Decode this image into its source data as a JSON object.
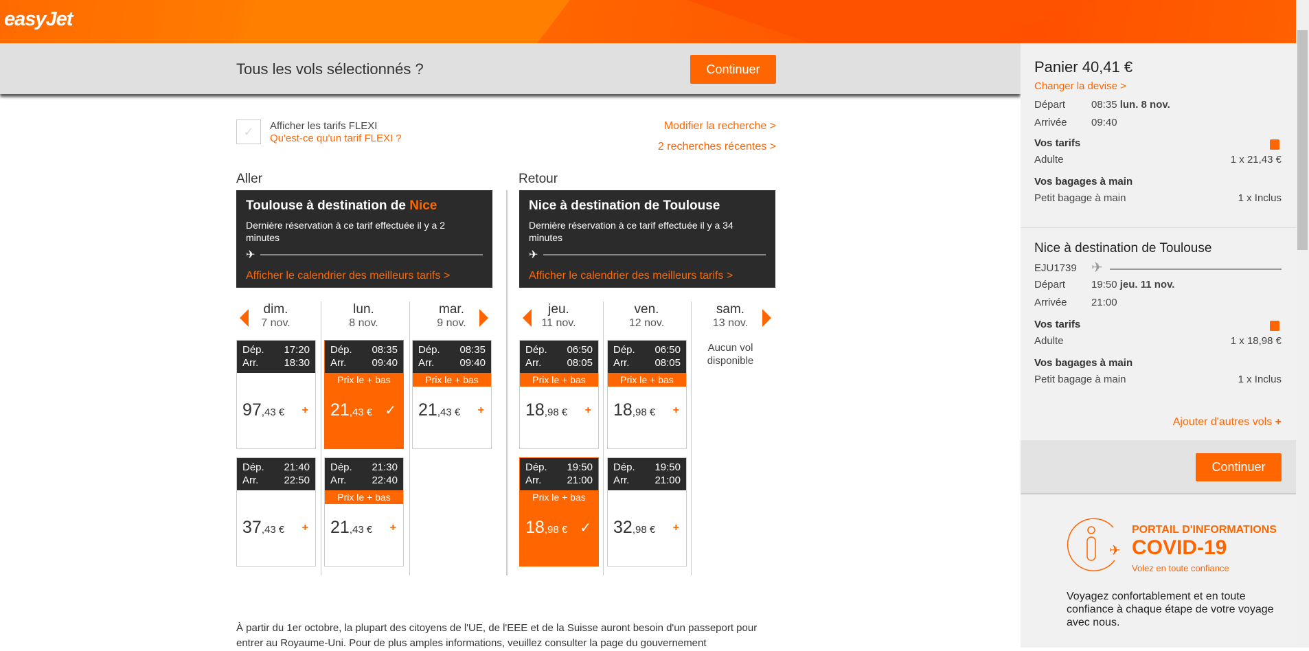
{
  "header": {
    "logo": "easyJet"
  },
  "bar": {
    "title": "Tous les vols sélectionnés ?",
    "continue": "Continuer"
  },
  "options": {
    "flexi_label": "Afficher les tarifs FLEXI",
    "flexi_help": "Qu'est-ce qu'un tarif FLEXI ?",
    "flexi_checked": false,
    "modify": "Modifier la recherche >",
    "recent": "2 recherches récentes >"
  },
  "outbound": {
    "section": "Aller",
    "title_prefix": "Toulouse à destination de ",
    "title_dest": "Nice",
    "last_booking": "Dernière réservation à ce tarif effectuée il y a 2 minutes",
    "calendar": "Afficher le calendrier des meilleurs tarifs >",
    "days": [
      {
        "day": "dim.",
        "date": "7 nov.",
        "flights": [
          {
            "dep_label": "Dép.",
            "dep": "17:20",
            "arr_label": "Arr.",
            "arr": "18:30",
            "badge": "",
            "int": "97",
            "dec": ",43 €",
            "selected": false
          },
          {
            "dep_label": "Dép.",
            "dep": "21:40",
            "arr_label": "Arr.",
            "arr": "22:50",
            "badge": "",
            "int": "37",
            "dec": ",43 €",
            "selected": false
          }
        ]
      },
      {
        "day": "lun.",
        "date": "8 nov.",
        "flights": [
          {
            "dep_label": "Dép.",
            "dep": "08:35",
            "arr_label": "Arr.",
            "arr": "09:40",
            "badge": "Prix le + bas",
            "int": "21",
            "dec": ",43 €",
            "selected": true
          },
          {
            "dep_label": "Dép.",
            "dep": "21:30",
            "arr_label": "Arr.",
            "arr": "22:40",
            "badge": "Prix le + bas",
            "int": "21",
            "dec": ",43 €",
            "selected": false
          }
        ]
      },
      {
        "day": "mar.",
        "date": "9 nov.",
        "flights": [
          {
            "dep_label": "Dép.",
            "dep": "08:35",
            "arr_label": "Arr.",
            "arr": "09:40",
            "badge": "Prix le + bas",
            "int": "21",
            "dec": ",43 €",
            "selected": false
          }
        ]
      }
    ]
  },
  "return": {
    "section": "Retour",
    "title_prefix": "Nice à destination de ",
    "title_dest": "Toulouse",
    "last_booking": "Dernière réservation à ce tarif effectuée il y a 34 minutes",
    "calendar": "Afficher le calendrier des meilleurs tarifs >",
    "days": [
      {
        "day": "jeu.",
        "date": "11 nov.",
        "flights": [
          {
            "dep_label": "Dép.",
            "dep": "06:50",
            "arr_label": "Arr.",
            "arr": "08:05",
            "badge": "Prix le + bas",
            "int": "18",
            "dec": ",98 €",
            "selected": false
          },
          {
            "dep_label": "Dép.",
            "dep": "19:50",
            "arr_label": "Arr.",
            "arr": "21:00",
            "badge": "Prix le + bas",
            "int": "18",
            "dec": ",98 €",
            "selected": true
          }
        ]
      },
      {
        "day": "ven.",
        "date": "12 nov.",
        "flights": [
          {
            "dep_label": "Dép.",
            "dep": "06:50",
            "arr_label": "Arr.",
            "arr": "08:05",
            "badge": "Prix le + bas",
            "int": "18",
            "dec": ",98 €",
            "selected": false
          },
          {
            "dep_label": "Dép.",
            "dep": "19:50",
            "arr_label": "Arr.",
            "arr": "21:00",
            "badge": "",
            "int": "32",
            "dec": ",98 €",
            "selected": false
          }
        ]
      },
      {
        "day": "sam.",
        "date": "13 nov.",
        "none": "Aucun vol disponible",
        "flights": []
      }
    ]
  },
  "footer": {
    "text": "À partir du 1er octobre, la plupart des citoyens de l'UE, de l'EEE et de la Suisse auront besoin d'un passeport pour entrer au Royaume-Uni. Pour de plus amples informations, veuillez consulter la page du gouvernement"
  },
  "basket": {
    "title": "Panier 40,41 €",
    "currency": "Changer la devise >",
    "f1": {
      "dep_label": "Départ",
      "dep_time": "08:35",
      "dep_date": "lun. 8 nov.",
      "arr_label": "Arrivée",
      "arr_time": "09:40",
      "fares": "Vos tarifs",
      "pax": "Adulte",
      "price": "1 x 21,43 €",
      "bags": "Vos bagages à main",
      "bag": "Petit bagage à main",
      "bag_qty": "1 x Inclus"
    },
    "f2": {
      "title": "Nice à destination de Toulouse",
      "flight_no": "EJU1739",
      "dep_label": "Départ",
      "dep_time": "19:50",
      "dep_date": "jeu. 11 nov.",
      "arr_label": "Arrivée",
      "arr_time": "21:00",
      "fares": "Vos tarifs",
      "pax": "Adulte",
      "price": "1 x 18,98 €",
      "bags": "Vos bagages à main",
      "bag": "Petit bagage à main",
      "bag_qty": "1 x Inclus"
    },
    "add": "Ajouter d'autres vols",
    "continue": "Continuer",
    "covid": {
      "l1": "PORTAIL D'INFORMATIONS",
      "l2": "COVID-19",
      "l3": "Volez en toute confiance",
      "body": "Voyagez confortablement et en toute confiance à chaque étape de votre voyage avec nous."
    }
  },
  "colors": {
    "accent": "#ff6600",
    "dark": "#2b2b2b"
  }
}
